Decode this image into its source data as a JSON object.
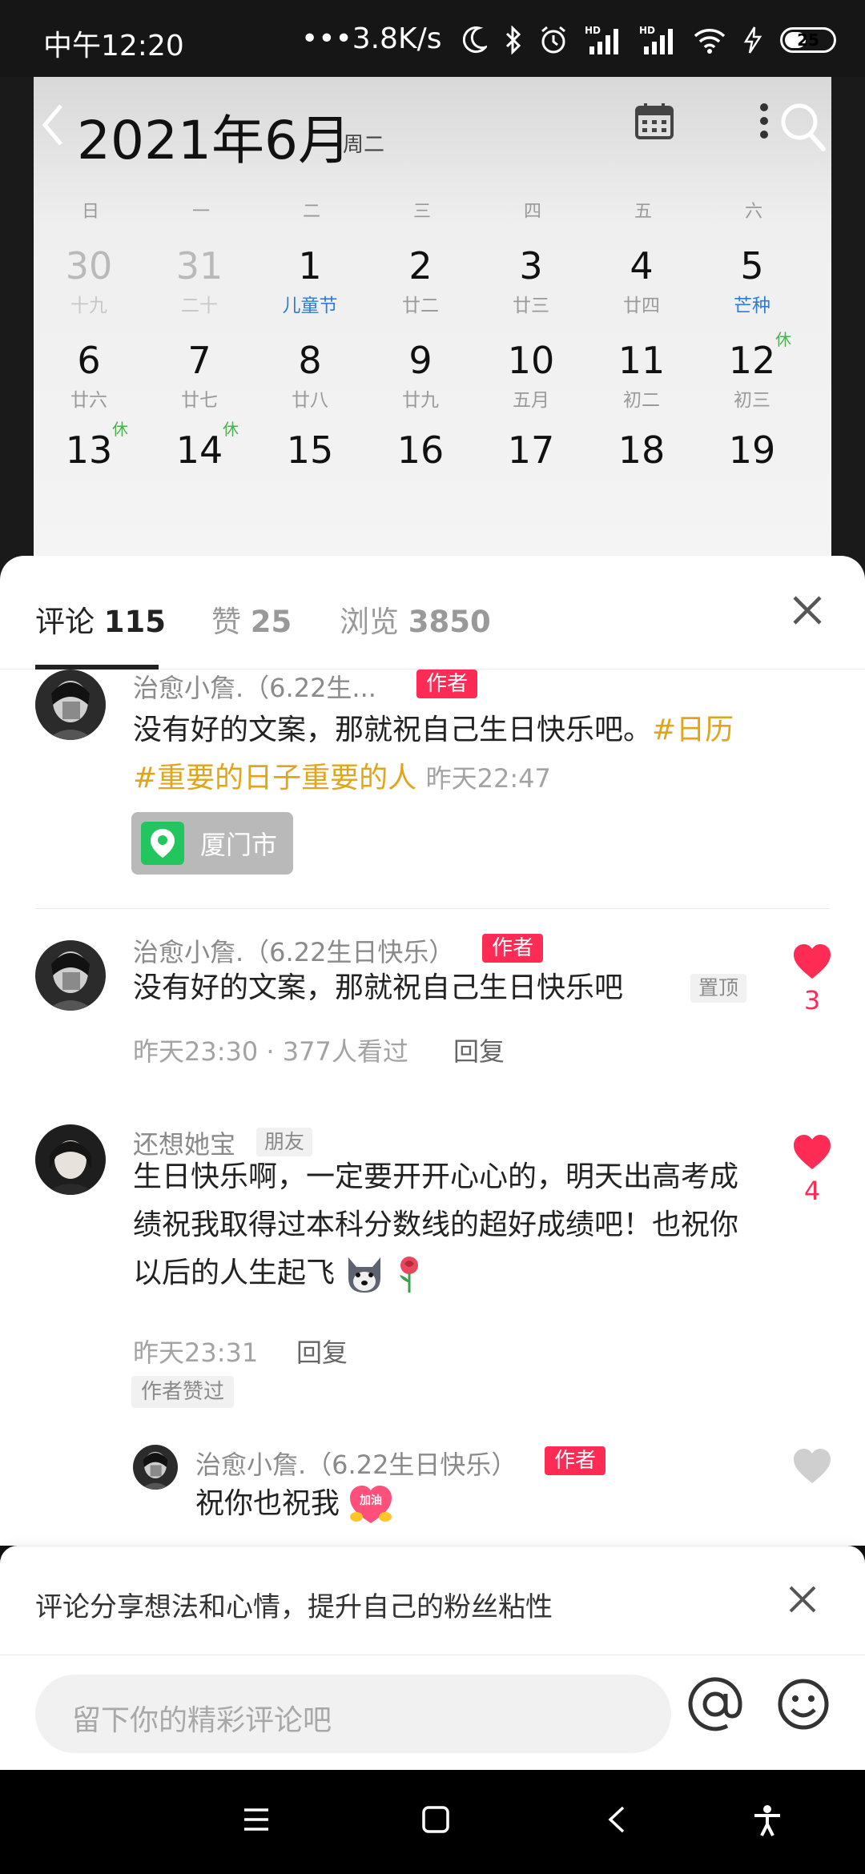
{
  "status_bar": {
    "time": "中午12:20",
    "speed": "•••3.8K/s",
    "battery": "25",
    "icons": [
      "moon-icon",
      "bluetooth-icon",
      "alarm-icon",
      "hd-signal-icon",
      "hd-signal-icon",
      "wifi-icon",
      "charging-icon",
      "battery-icon"
    ]
  },
  "calendar": {
    "month_title": "2021年6月",
    "weekday": "周二",
    "week_headers": [
      "日",
      "一",
      "二",
      "三",
      "四",
      "五",
      "六"
    ],
    "rows": [
      [
        {
          "day": "30",
          "lunar": "十九",
          "muted": true
        },
        {
          "day": "31",
          "lunar": "二十",
          "muted": true
        },
        {
          "day": "1",
          "lunar": "儿童节",
          "festival": true
        },
        {
          "day": "2",
          "lunar": "廿二"
        },
        {
          "day": "3",
          "lunar": "廿三"
        },
        {
          "day": "4",
          "lunar": "廿四"
        },
        {
          "day": "5",
          "lunar": "芒种",
          "festival": true
        }
      ],
      [
        {
          "day": "6",
          "lunar": "廿六"
        },
        {
          "day": "7",
          "lunar": "廿七"
        },
        {
          "day": "8",
          "lunar": "廿八"
        },
        {
          "day": "9",
          "lunar": "廿九"
        },
        {
          "day": "10",
          "lunar": "五月"
        },
        {
          "day": "11",
          "lunar": "初二"
        },
        {
          "day": "12",
          "lunar": "初三",
          "rest": "休"
        }
      ],
      [
        {
          "day": "13",
          "lunar": "",
          "rest": "休"
        },
        {
          "day": "14",
          "lunar": "",
          "rest": "休"
        },
        {
          "day": "15",
          "lunar": ""
        },
        {
          "day": "16",
          "lunar": ""
        },
        {
          "day": "17",
          "lunar": ""
        },
        {
          "day": "18",
          "lunar": ""
        },
        {
          "day": "19",
          "lunar": ""
        }
      ]
    ]
  },
  "tabs": [
    {
      "label": "评论",
      "count": "115",
      "active": true
    },
    {
      "label": "赞",
      "count": "25",
      "active": false
    },
    {
      "label": "浏览",
      "count": "3850",
      "active": false
    }
  ],
  "comments": {
    "pinned_post": {
      "name": "治愈小詹.（6.22生...",
      "author_tag": "作者",
      "text_plain": "没有好的文案，那就祝自己生日快乐吧。",
      "hashtag1": "#日历",
      "hashtag2": "#重要的日子重要的人",
      "time": "昨天22:47",
      "location": "厦门市"
    },
    "c1": {
      "name": "治愈小詹.（6.22生日快乐）",
      "author_tag": "作者",
      "text": "没有好的文案，那就祝自己生日快乐吧",
      "pinned_tag": "置顶",
      "meta": "昨天23:30 · 377人看过",
      "reply": "回复",
      "likes": "3"
    },
    "c2": {
      "name": "还想她宝",
      "friend_tag": "朋友",
      "text": "生日快乐啊，一定要开开心心的，明天出高考成绩祝我取得过本科分数线的超好成绩吧！也祝你以后的人生起飞",
      "time": "昨天23:31",
      "reply": "回复",
      "liked_by_author": "作者赞过",
      "likes": "4"
    },
    "c3": {
      "name": "治愈小詹.（6.22生日快乐）",
      "author_tag": "作者",
      "text": "祝你也祝我",
      "sticker": "加油"
    }
  },
  "tip": {
    "text": "评论分享想法和心情，提升自己的粉丝粘性"
  },
  "input": {
    "placeholder": "留下你的精彩评论吧"
  },
  "colors": {
    "accent_red": "#fe2c55",
    "hashtag": "#e1a51c",
    "festival": "#2f7dd3",
    "rest": "#4caf50"
  }
}
